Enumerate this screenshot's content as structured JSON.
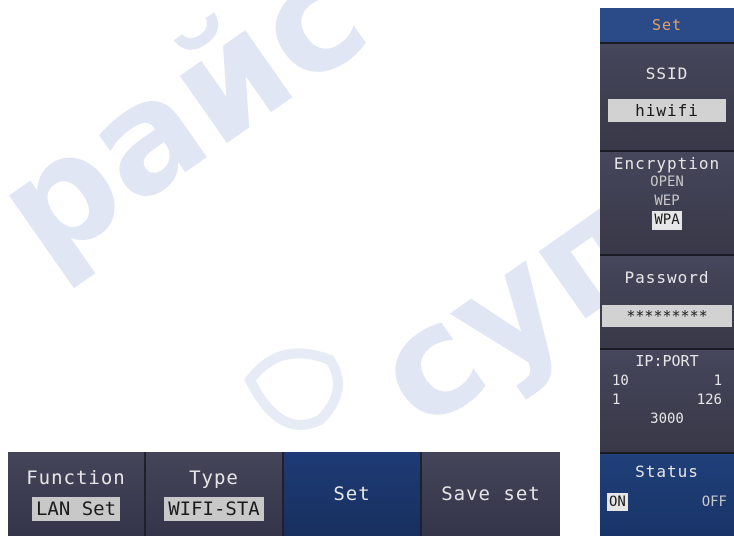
{
  "watermark": {
    "text_left": "райс",
    "text_right": "супер",
    "color": "#c9d2ec"
  },
  "softkeys": {
    "function": {
      "label": "Function",
      "value": "LAN Set"
    },
    "type": {
      "label": "Type",
      "value": "WIFI-STA"
    },
    "set": {
      "label": "Set"
    },
    "save_set": {
      "label": "Save set"
    }
  },
  "menu": {
    "title": "Set",
    "ssid": {
      "label": "SSID",
      "value": "hiwifi"
    },
    "encryption": {
      "label": "Encryption",
      "options": [
        "OPEN",
        "WEP",
        "WPA"
      ],
      "selected": "WPA"
    },
    "password": {
      "label": "Password",
      "value": "*********"
    },
    "ip_port": {
      "label": "IP:PORT",
      "ip": [
        "10",
        "1",
        "1",
        "126"
      ],
      "port": "3000"
    },
    "status": {
      "label": "Status",
      "on": "ON",
      "off": "OFF",
      "selected": "ON"
    }
  },
  "colors": {
    "panel_bg": "#3a3a4e",
    "active_blue": "#1f3b76",
    "title_orange": "#e8a060"
  }
}
